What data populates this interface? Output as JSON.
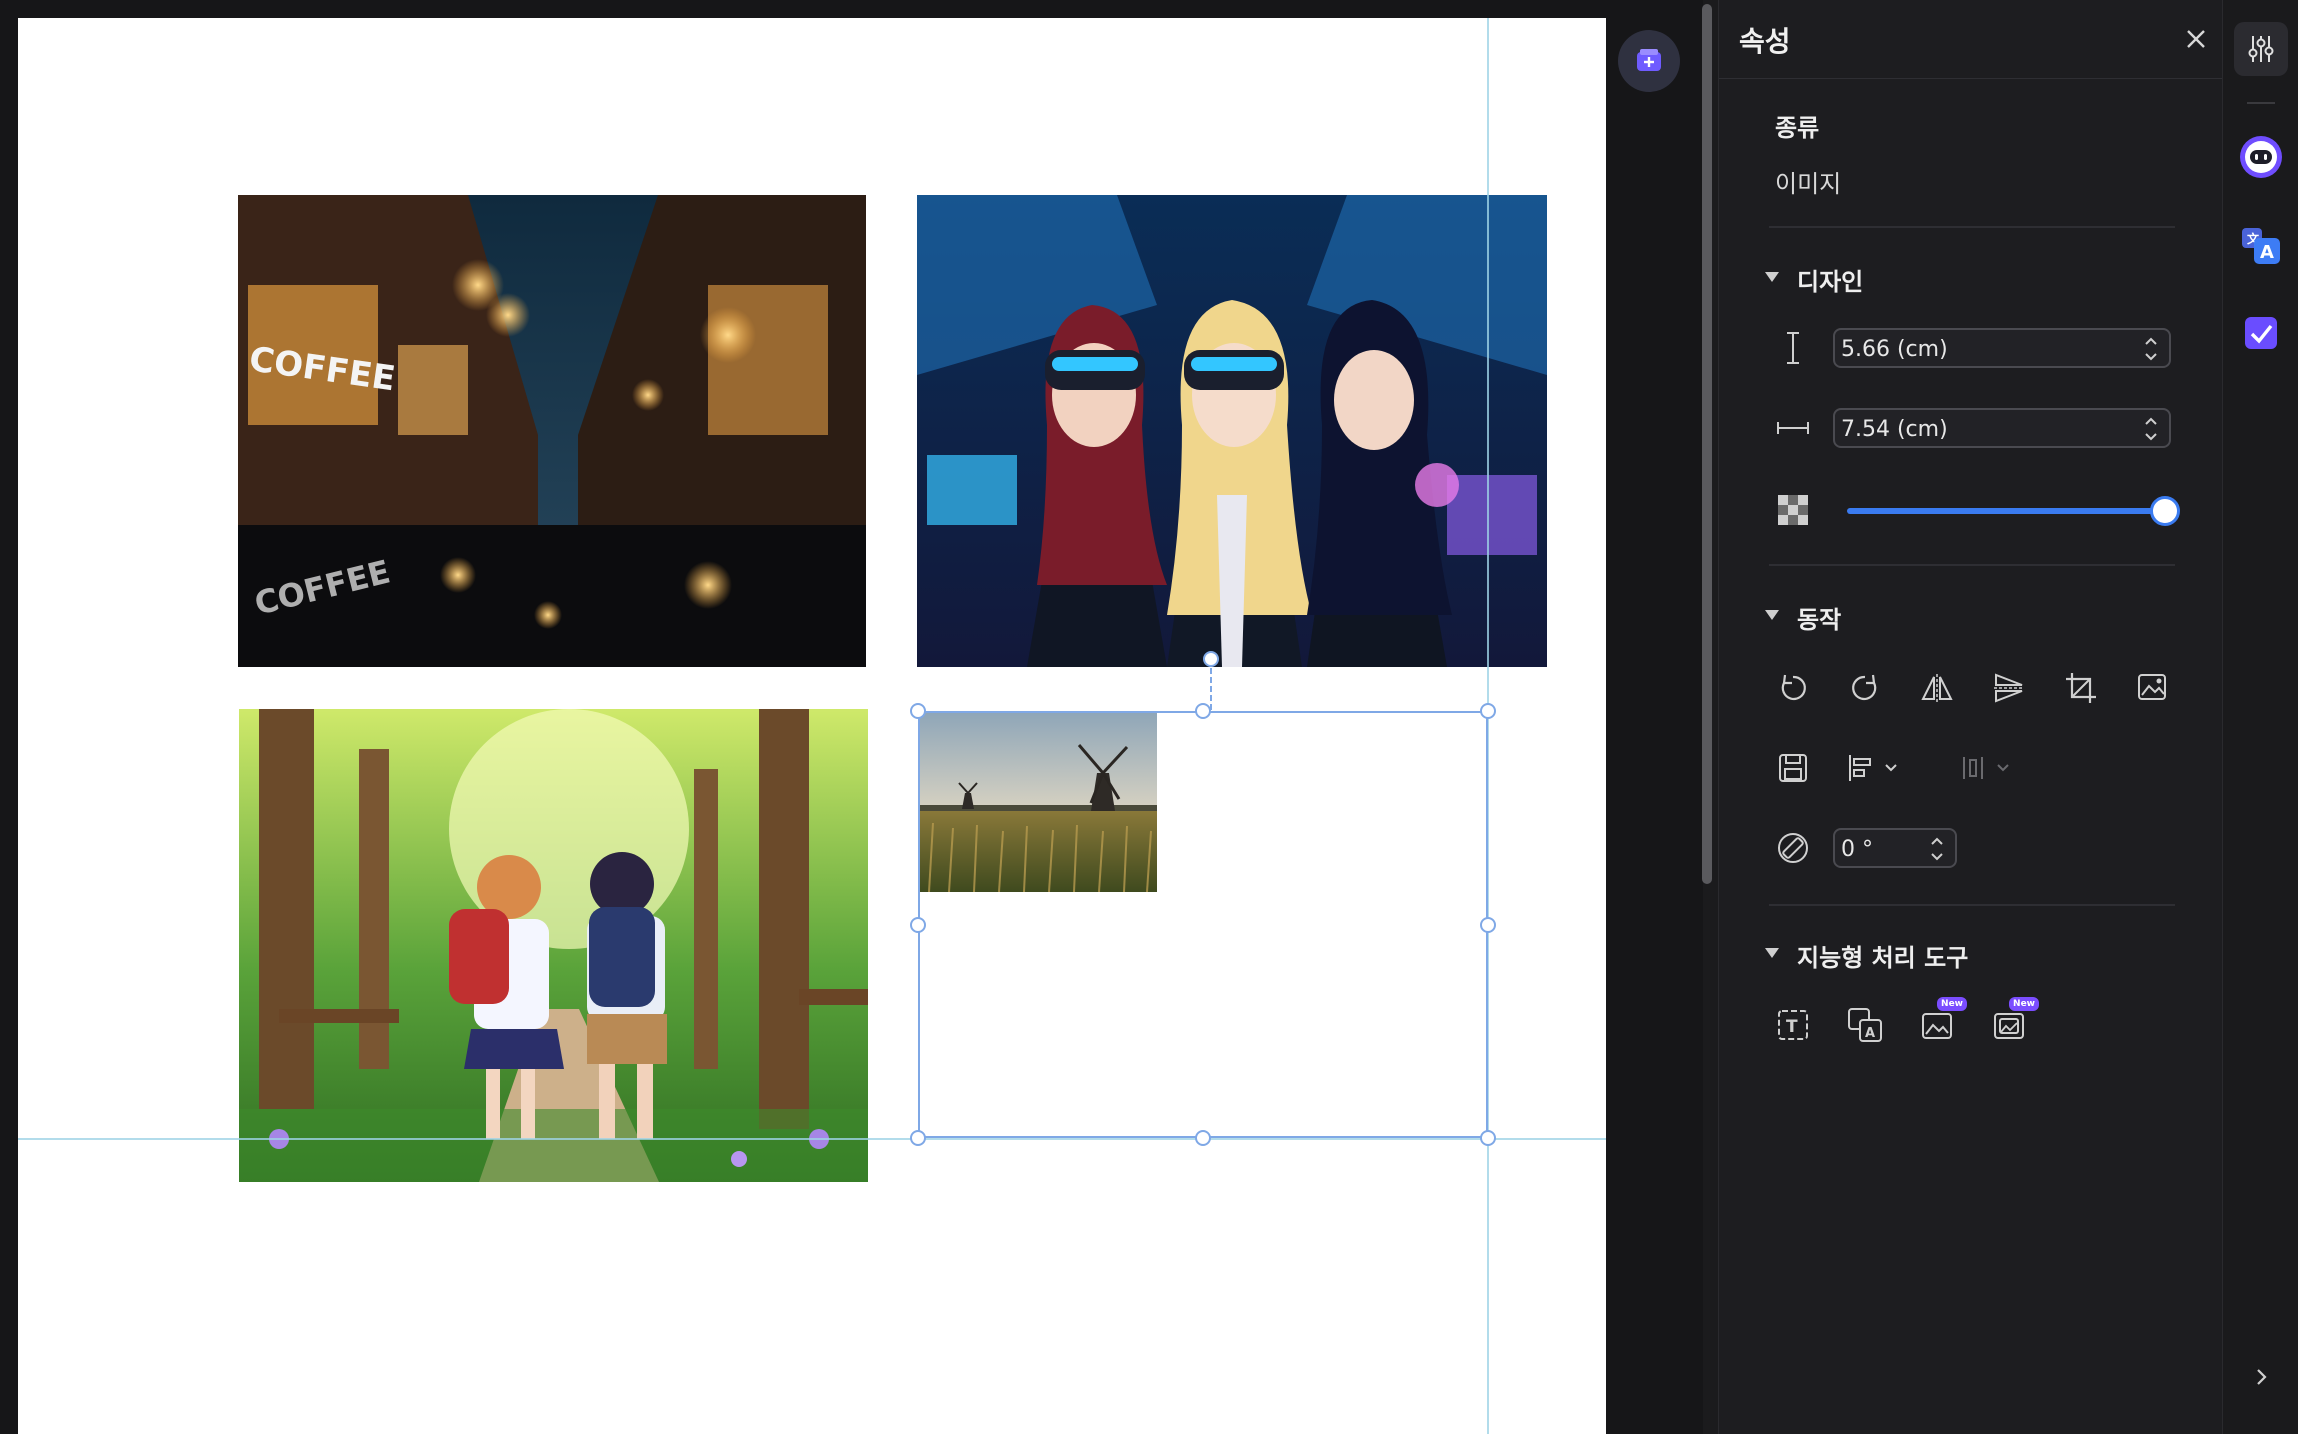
{
  "panel": {
    "title": "속성",
    "type_section": {
      "label": "종류",
      "value": "이미지"
    },
    "design_section": {
      "label": "디자인",
      "height_value": "5.66 (cm)",
      "width_value": "7.54 (cm)",
      "opacity": 1.0
    },
    "action_section": {
      "label": "동작",
      "rotation_value": "0 °"
    },
    "smart_section": {
      "label": "지능형 처리 도구",
      "new_badge": "New"
    }
  },
  "colors": {
    "accent": "#3a7bf0",
    "selection": "#7fa8e6",
    "guide": "#9fd3e6",
    "panel_bg": "#1d1d20"
  }
}
